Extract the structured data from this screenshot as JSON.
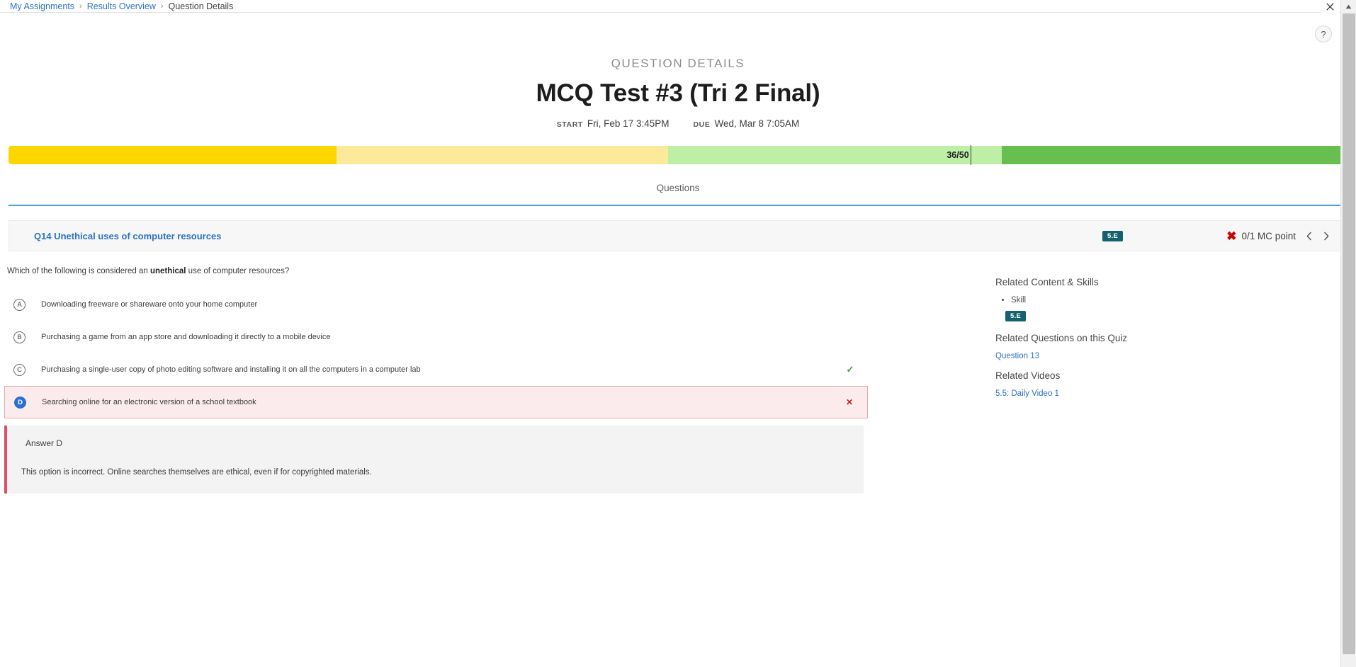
{
  "breadcrumb": {
    "items": [
      {
        "label": "My Assignments",
        "current": false
      },
      {
        "label": "Results Overview",
        "current": false
      },
      {
        "label": "Question Details",
        "current": true
      }
    ],
    "separator": "›"
  },
  "window": {
    "close_label": "✕",
    "help_label": "?"
  },
  "header": {
    "eyebrow": "QUESTION DETAILS",
    "title": "MCQ Test #3 (Tri 2 Final)",
    "start_label": "START",
    "start_value": "Fri, Feb 17 3:45PM",
    "due_label": "DUE",
    "due_value": "Wed, Mar 8 7:05AM"
  },
  "progress": {
    "score_label": "36/50",
    "score_numerator": 36,
    "score_denominator": 50,
    "segments": [
      {
        "name": "low",
        "color": "#fdd600",
        "percent": 24.6
      },
      {
        "name": "mid-low",
        "color": "#fde99a",
        "percent": 24.8
      },
      {
        "name": "mid-high",
        "color": "#bdefa7",
        "percent": 25.0
      },
      {
        "name": "high",
        "color": "#66bf4f",
        "percent": 25.6
      }
    ],
    "marker_percent": 72.1
  },
  "tabs": {
    "items": [
      {
        "label": "Questions",
        "active": true
      }
    ],
    "accent_color": "#4aa3d8"
  },
  "question_header": {
    "title": "Q14 Unethical uses of computer resources",
    "skill_chip": "5.E",
    "score_text": "0/1 MC point",
    "score_icon": "x-mark-red",
    "prev_icon": "chevron-left-icon",
    "next_icon": "chevron-right-icon"
  },
  "question": {
    "prompt_before": "Which of the following is considered an ",
    "prompt_bold": "unethical",
    "prompt_after": " use of computer resources?",
    "options": [
      {
        "letter": "A",
        "text": "Downloading freeware or shareware onto your home computer",
        "selected": false,
        "state": "neutral",
        "mark": ""
      },
      {
        "letter": "B",
        "text": "Purchasing a game from an app store and downloading it directly to a mobile device",
        "selected": false,
        "state": "neutral",
        "mark": ""
      },
      {
        "letter": "C",
        "text": "Purchasing a single-user copy of photo editing software and installing it on all the computers in a computer lab",
        "selected": false,
        "state": "correct",
        "mark": "✓"
      },
      {
        "letter": "D",
        "text": "Searching online for an electronic version of a school textbook",
        "selected": true,
        "state": "wrong",
        "mark": "✕"
      }
    ]
  },
  "explanation": {
    "title": "Answer D",
    "body": "This option is incorrect. Online searches themselves are ethical, even if for copyrighted materials."
  },
  "sidebar": {
    "related_content_heading": "Related Content & Skills",
    "skill_item_label": "Skill",
    "skill_chip": "5.E",
    "related_questions_heading": "Related Questions on this Quiz",
    "related_question_link": "Question 13",
    "related_videos_heading": "Related Videos",
    "related_video_link": "5.5: Daily Video 1"
  },
  "colors": {
    "link": "#2c72c4",
    "skill_chip_bg": "#17616e",
    "wrong_bg": "#fbebec",
    "wrong_border": "#e8a9b0",
    "correct": "#3e9c3e",
    "wrong": "#cc2222",
    "selected_marker": "#2c6fd1",
    "explanation_accent": "#d94f6a"
  }
}
